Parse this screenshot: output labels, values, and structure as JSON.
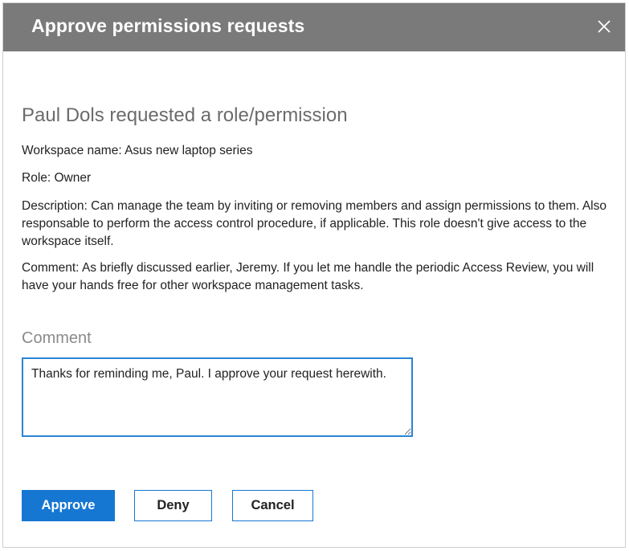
{
  "dialog": {
    "title": "Approve permissions requests",
    "close_icon": "close-icon"
  },
  "request": {
    "title": "Paul Dols requested a role/permission",
    "workspace": "Workspace name: Asus new laptop series",
    "role": "Role: Owner",
    "description": "Description: Can manage the team by inviting or removing members and assign permissions to them. Also responsable to perform the access control procedure, if applicable. This role doesn't give access to the workspace itself.",
    "comment": "Comment: As briefly discussed earlier, Jeremy. If you let me handle the periodic Access Review, you will have your hands free for other workspace management tasks."
  },
  "response": {
    "label": "Comment",
    "value": "Thanks for reminding me, Paul. I approve your request herewith."
  },
  "actions": {
    "approve": "Approve",
    "deny": "Deny",
    "cancel": "Cancel"
  },
  "colors": {
    "header_bg": "#7a7a7a",
    "accent": "#1677d2",
    "focus_border": "#2b84d3"
  }
}
